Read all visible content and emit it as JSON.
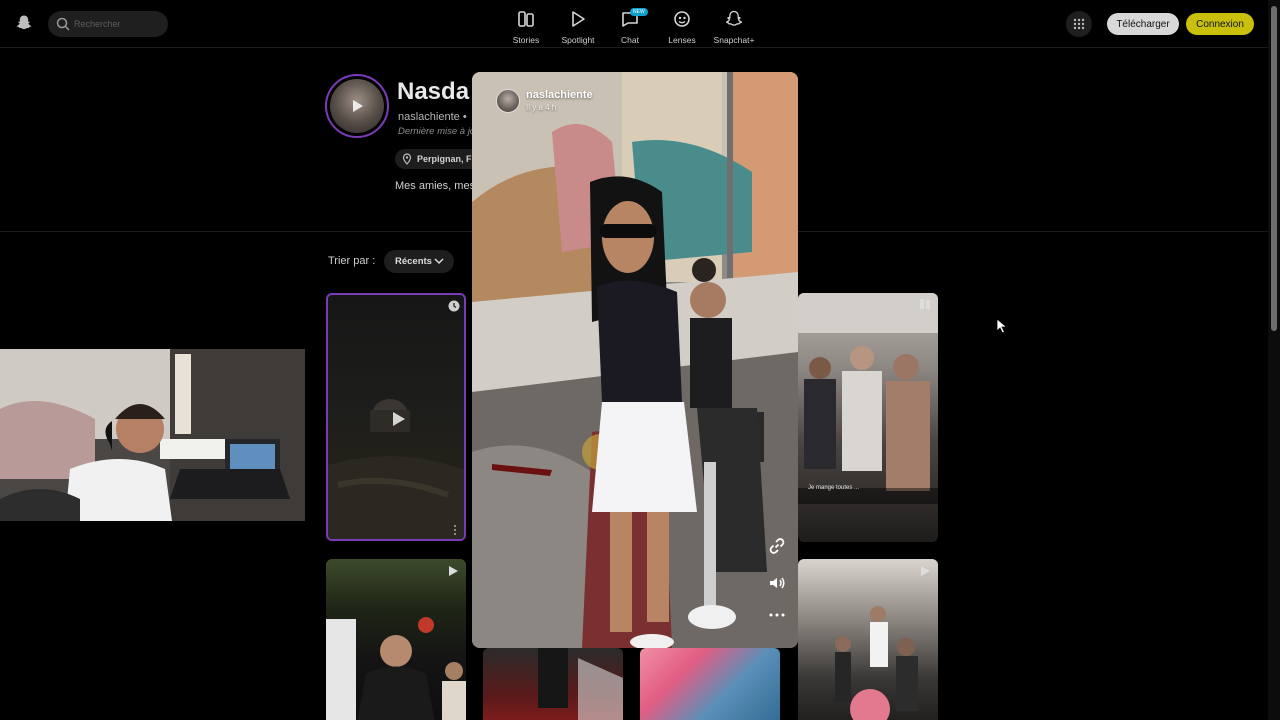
{
  "header": {
    "search_placeholder": "Rechercher",
    "nav": [
      {
        "label": "Stories",
        "icon": "stories-icon"
      },
      {
        "label": "Spotlight",
        "icon": "spotlight-play-icon"
      },
      {
        "label": "Chat",
        "icon": "chat-icon",
        "badge": "NEW"
      },
      {
        "label": "Lenses",
        "icon": "lenses-icon"
      },
      {
        "label": "Snapchat+",
        "icon": "snapchat-plus-icon"
      }
    ],
    "download_label": "Télécharger",
    "login_label": "Connexion"
  },
  "profile": {
    "name": "Nasda",
    "username": "naslachiente •",
    "updated": "Dernière mise à jo",
    "location": "Perpignan, Fr",
    "bio": "Mes amies, mes"
  },
  "sort": {
    "label": "Trier par :",
    "value": "Récents"
  },
  "tiles": {
    "caption_overlay": "Je mange toutes ..."
  },
  "story": {
    "username": "naslachiente",
    "time": "Il y a 4 h"
  },
  "colors": {
    "accent_purple": "#7b3bb8",
    "login_yellow": "#c8c00c",
    "badge_blue": "#0fa0ce"
  }
}
